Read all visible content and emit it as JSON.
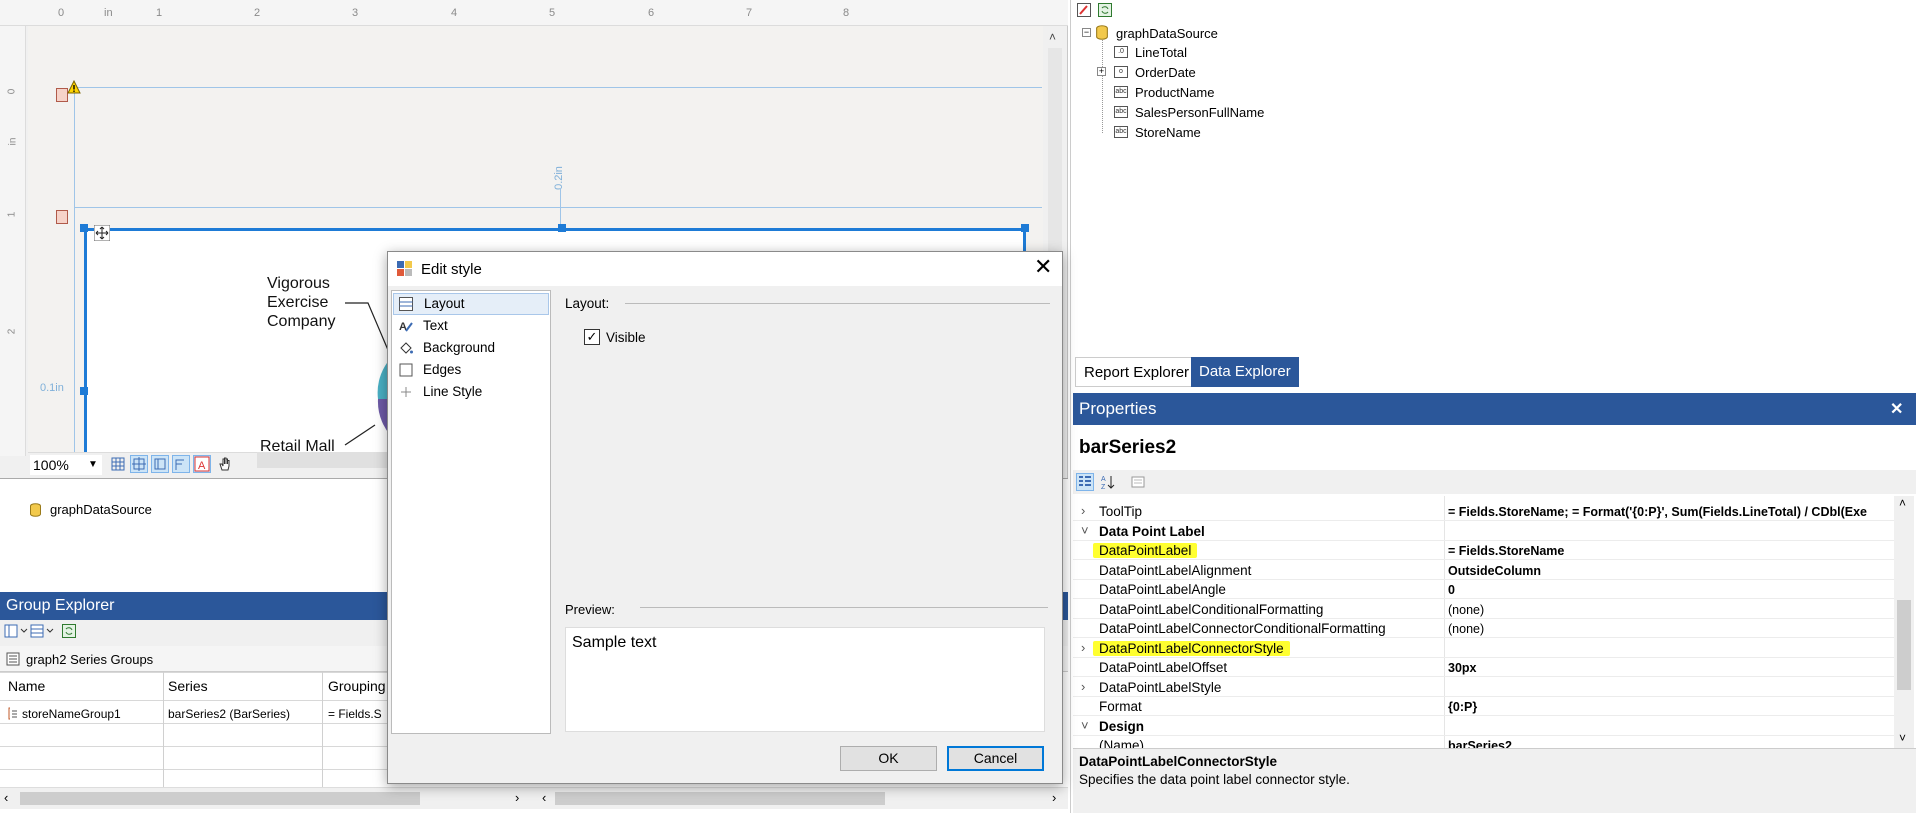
{
  "designer": {
    "ruler_top": [
      "0",
      "in",
      "1",
      "2",
      "3",
      "4",
      "5",
      "6",
      "7",
      "8"
    ],
    "ruler_left": [
      "0",
      "in",
      "1",
      "2"
    ],
    "dim_top": "0.2in",
    "dim_left": "0.1in",
    "pie_labels": [
      "Vigorous\nExercise\nCompany",
      "Retail Mall"
    ],
    "zoom": "100%"
  },
  "data_sources": {
    "item": "graphDataSource"
  },
  "group_explorer": {
    "title": "Group Explorer",
    "subtitle": "graph2 Series Groups",
    "columns": [
      "Name",
      "Series",
      "Grouping"
    ],
    "rows": [
      {
        "name": "storeNameGroup1",
        "series": "barSeries2 (BarSeries)",
        "grouping": "= Fields.S"
      }
    ]
  },
  "data_explorer": {
    "root": "graphDataSource",
    "fields": [
      {
        "name": "LineTotal",
        "icon": "numeric-field-icon"
      },
      {
        "name": "OrderDate",
        "icon": "date-field-icon"
      },
      {
        "name": "ProductName",
        "icon": "text-field-icon"
      },
      {
        "name": "SalesPersonFullName",
        "icon": "text-field-icon"
      },
      {
        "name": "StoreName",
        "icon": "text-field-icon"
      }
    ]
  },
  "tabs": [
    "Report Explorer",
    "Data Explorer"
  ],
  "properties": {
    "title": "Properties",
    "object_name": "barSeries2",
    "rows": [
      {
        "name": "ToolTip",
        "value": "= Fields.StoreName; = Format('{0:P}', Sum(Fields.LineTotal) / CDbl(Exe",
        "expand": ">"
      },
      {
        "name": "Data Point Label",
        "value": "",
        "category": true,
        "expand": "v"
      },
      {
        "name": "DataPointLabel",
        "value": "= Fields.StoreName",
        "highlight": true
      },
      {
        "name": "DataPointLabelAlignment",
        "value": "OutsideColumn"
      },
      {
        "name": "DataPointLabelAngle",
        "value": "0"
      },
      {
        "name": "DataPointLabelConditionalFormatting",
        "value": "(none)",
        "normal": true
      },
      {
        "name": "DataPointLabelConnectorConditionalFormatting",
        "value": "(none)",
        "normal": true
      },
      {
        "name": "DataPointLabelConnectorStyle",
        "value": "",
        "highlight": true,
        "expand": ">"
      },
      {
        "name": "DataPointLabelOffset",
        "value": "30px"
      },
      {
        "name": "DataPointLabelStyle",
        "value": "",
        "expand": ">"
      },
      {
        "name": "Format",
        "value": "{0:P}"
      },
      {
        "name": "Design",
        "value": "",
        "category": true,
        "expand": "v"
      },
      {
        "name": "(Name)",
        "value": "barSeries2"
      }
    ],
    "desc_title": "DataPointLabelConnectorStyle",
    "desc_text": "Specifies the data point label connector style."
  },
  "dialog": {
    "title": "Edit style",
    "nav": [
      "Layout",
      "Text",
      "Background",
      "Edges",
      "Line Style"
    ],
    "section_label": "Layout:",
    "visible_label": "Visible",
    "visible_checked": "✓",
    "preview_label": "Preview:",
    "preview_text": "Sample text",
    "ok": "OK",
    "cancel": "Cancel"
  },
  "colors": {
    "accent": "#2b579a",
    "selection": "#1e7bd6",
    "highlight": "#ffff30"
  }
}
